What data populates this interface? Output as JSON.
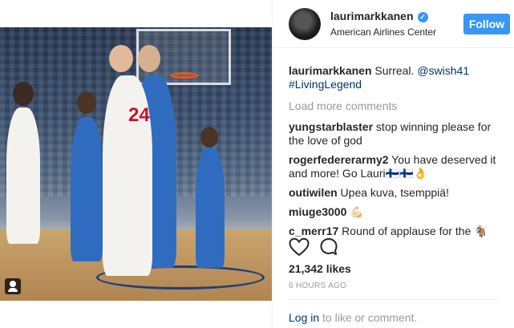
{
  "post": {
    "username": "laurimarkkanen",
    "verified_mark": "✓",
    "location": "American Airlines Center",
    "follow_label": "Follow",
    "caption_user": "laurimarkkanen",
    "caption_text": " Surreal. ",
    "caption_mention": "@swish41",
    "caption_hashtag": "#LivingLegend",
    "jersey_number": "24",
    "load_more": "Load more comments",
    "comments": [
      {
        "user": "yungstarblaster",
        "text": " stop winning please for the love of god"
      },
      {
        "user": "rogerfedererarmy2",
        "text": " You have deserved it and more! Go Lauri🇫🇮🇫🇮👌"
      },
      {
        "user": "outiwilen",
        "text": " Upea kuva, tsemppiä!"
      },
      {
        "user": "miuge3000",
        "text": " 💪🏻"
      },
      {
        "user": "c_merr17",
        "text": " Round of applause for the 🐐"
      }
    ],
    "likes": "21,342 likes",
    "time": "6 HOURS AGO",
    "login_link": "Log in",
    "login_text": " to like or comment."
  },
  "icons": {
    "heart": "heart-icon",
    "comment": "comment-icon",
    "tag": "user-tag-icon",
    "verified": "verified-badge-icon"
  },
  "colors": {
    "accent": "#3897f0",
    "link": "#003569",
    "muted": "#999999"
  }
}
